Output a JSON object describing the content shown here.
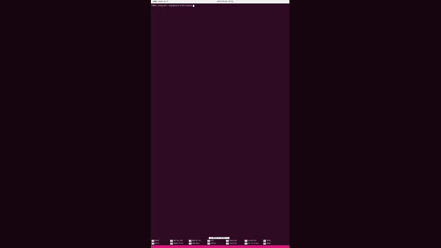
{
  "titlebar": {
    "version": "GNU nano 6.2",
    "filename": "Untitled.file"
  },
  "editor": {
    "line1": "TEXT analyst: keyboard efficiency"
  },
  "status": {
    "message": "[ Read 0 lines ]"
  },
  "shortcuts": {
    "row1": [
      {
        "key": "^G",
        "label": "Help"
      },
      {
        "key": "^O",
        "label": "Write Out"
      },
      {
        "key": "^W",
        "label": "Where Is"
      },
      {
        "key": "^K",
        "label": "Cut"
      },
      {
        "key": "^T",
        "label": "Execute"
      },
      {
        "key": "^C",
        "label": "Location"
      },
      {
        "key": "M-U",
        "label": "Undo"
      }
    ],
    "row2": [
      {
        "key": "^X",
        "label": "Exit"
      },
      {
        "key": "^R",
        "label": "Read File"
      },
      {
        "key": "^\\",
        "label": "Replace"
      },
      {
        "key": "^U",
        "label": "Paste"
      },
      {
        "key": "^J",
        "label": "Justify"
      },
      {
        "key": "^/",
        "label": "Go To Line"
      },
      {
        "key": "M-E",
        "label": "Redo"
      }
    ]
  },
  "colors": {
    "terminal_bg": "#2f0a23",
    "outer_bg": "#16050f",
    "accent_strip": "#d6147a"
  }
}
